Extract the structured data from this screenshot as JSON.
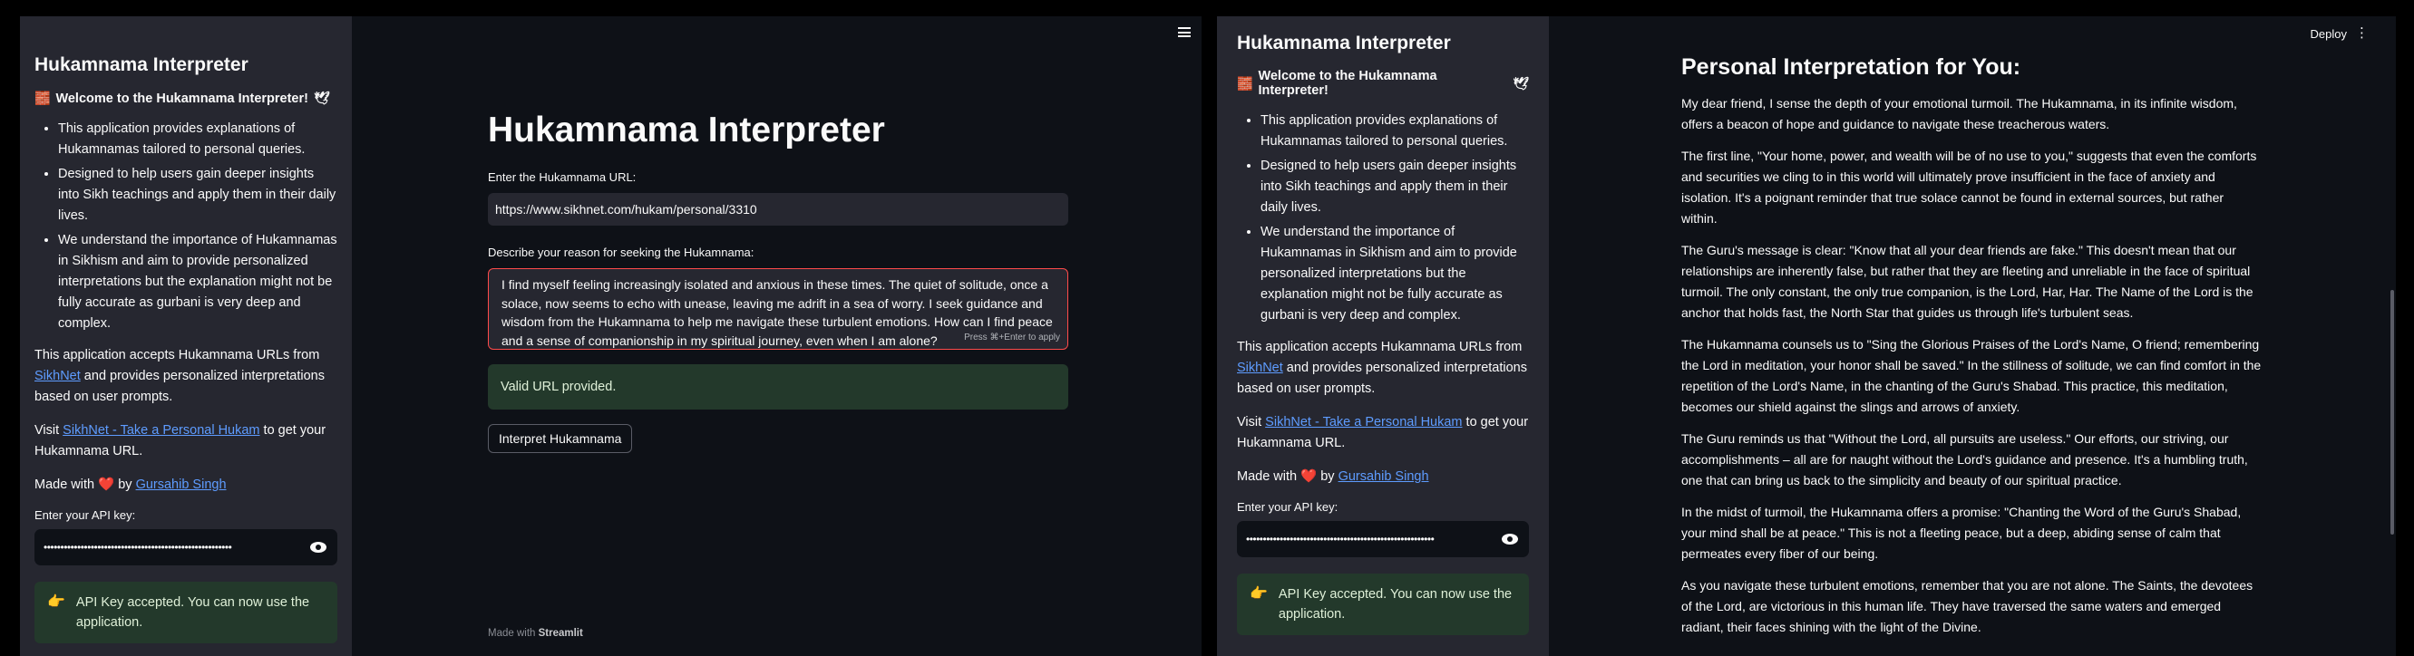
{
  "sidebar": {
    "title": "Hukamnama Interpreter",
    "welcome": "Welcome to the Hukamnama Interpreter!",
    "welcome_emoji_left": "🧱",
    "welcome_emoji_right": "🕊",
    "bullets": [
      "This application provides explanations of Hukamnamas tailored to personal queries.",
      "Designed to help users gain deeper insights into Sikh teachings and apply them in their daily lives.",
      "We understand the importance of Hukamnamas in Sikhism and aim to provide personalized interpretations but the explanation might not be fully accurate as gurbani is very deep and complex."
    ],
    "accepts_prefix": "This application accepts Hukamnama URLs from ",
    "accepts_link": "SikhNet",
    "accepts_suffix": " and provides personalized interpretations based on user prompts.",
    "visit_prefix": "Visit ",
    "visit_link": "SikhNet - Take a Personal Hukam",
    "visit_suffix": " to get your Hukamnama URL.",
    "made_prefix": "Made with ",
    "made_heart": "❤️",
    "made_by": " by ",
    "made_link": "Gursahib Singh",
    "api_label": "Enter your API key:",
    "api_value": "••••••••••••••••••••••••••••••••••••••••••••••••••••••••",
    "api_success_icon": "👉",
    "api_success": "API Key accepted. You can now use the application."
  },
  "main": {
    "title": "Hukamnama Interpreter",
    "url_label": "Enter the Hukamnama URL:",
    "url_value": "https://www.sikhnet.com/hukam/personal/3310",
    "reason_label": "Describe your reason for seeking the Hukamnama:",
    "reason_value": "I find myself feeling increasingly isolated and anxious in these times. The quiet of solitude, once a solace, now seems to echo with unease, leaving me adrift in a sea of worry. I seek guidance and wisdom from the Hukamnama to help me navigate these turbulent emotions. How can I find peace and a sense of companionship in my spiritual journey, even when I am alone?",
    "reason_hint": "Press ⌘+Enter to apply",
    "valid_message": "Valid URL provided.",
    "interpret_button": "Interpret Hukamnama",
    "footer_prefix": "Made with ",
    "footer_brand": "Streamlit"
  },
  "right": {
    "deploy": "Deploy",
    "kebab": "⋮",
    "interp_title": "Personal Interpretation for You:",
    "paragraphs": [
      "My dear friend, I sense the depth of your emotional turmoil. The Hukamnama, in its infinite wisdom, offers a beacon of hope and guidance to navigate these treacherous waters.",
      "The first line, \"Your home, power, and wealth will be of no use to you,\" suggests that even the comforts and securities we cling to in this world will ultimately prove insufficient in the face of anxiety and isolation. It's a poignant reminder that true solace cannot be found in external sources, but rather within.",
      "The Guru's message is clear: \"Know that all your dear friends are fake.\" This doesn't mean that our relationships are inherently false, but rather that they are fleeting and unreliable in the face of spiritual turmoil. The only constant, the only true companion, is the Lord, Har, Har. The Name of the Lord is the anchor that holds fast, the North Star that guides us through life's turbulent seas.",
      "The Hukamnama counsels us to \"Sing the Glorious Praises of the Lord's Name, O friend; remembering the Lord in meditation, your honor shall be saved.\" In the stillness of solitude, we can find comfort in the repetition of the Lord's Name, in the chanting of the Guru's Shabad. This practice, this meditation, becomes our shield against the slings and arrows of anxiety.",
      "The Guru reminds us that \"Without the Lord, all pursuits are useless.\" Our efforts, our striving, our accomplishments – all are for naught without the Lord's guidance and presence. It's a humbling truth, one that can bring us back to the simplicity and beauty of our spiritual practice.",
      "In the midst of turmoil, the Hukamnama offers a promise: \"Chanting the Word of the Guru's Shabad, your mind shall be at peace.\" This is not a fleeting peace, but a deep, abiding sense of calm that permeates every fiber of our being.",
      "As you navigate these turbulent emotions, remember that you are not alone. The Saints, the devotees of the Lord, are victorious in this human life. They have traversed the same waters and emerged radiant, their faces shining with the light of the Divine."
    ]
  },
  "colors": {
    "app_bg": "#0e1117",
    "sidebar_bg": "#262730",
    "success_bg": "#23392b",
    "accent_red": "#ff4b4b",
    "link": "#5e9cff"
  }
}
